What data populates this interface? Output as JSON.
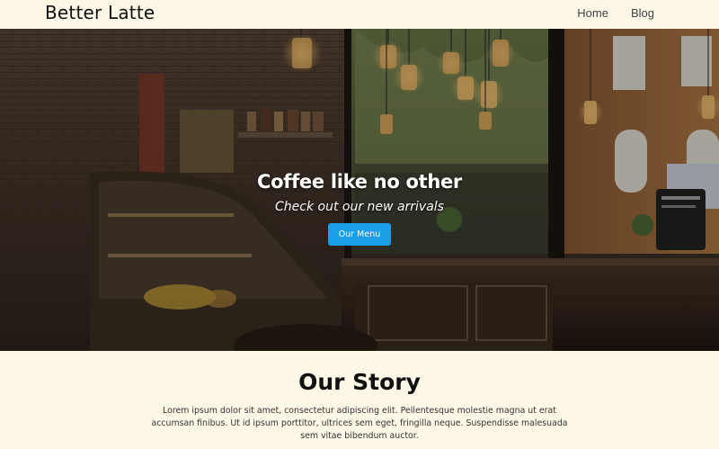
{
  "navbar": {
    "brand": "Better Latte",
    "links": [
      {
        "label": "Home"
      },
      {
        "label": "Blog"
      }
    ]
  },
  "hero": {
    "title": "Coffee like no other",
    "subtitle": "Check out our new arrivals",
    "button_label": "Our Menu",
    "button_color": "#1a9ee8"
  },
  "story": {
    "title": "Our Story",
    "text": "Lorem ipsum dolor sit amet, consectetur adipiscing elit. Pellentesque molestie magna ut erat accumsan finibus. Ut id ipsum porttitor, ultrices sem eget, fringilla neque. Suspendisse malesuada sem vitae bibendum auctor."
  },
  "colors": {
    "page_background": "#fdf8e8",
    "accent": "#1a9ee8"
  }
}
